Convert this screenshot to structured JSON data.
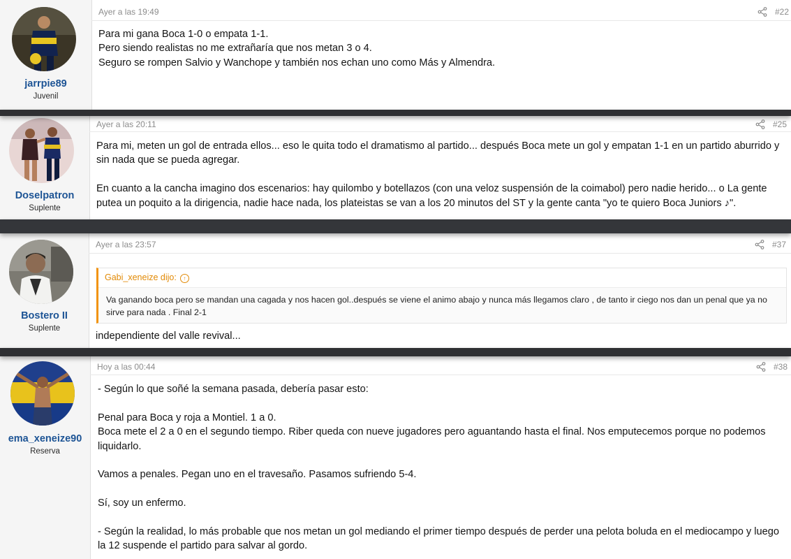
{
  "posts": [
    {
      "username": "jarrpie89",
      "user_title": "Juvenil",
      "timestamp": "Ayer a las 19:49",
      "post_number": "#22",
      "paragraphs": [
        "Para mi gana Boca 1-0 o empata 1-1.",
        "Pero siendo realistas no me extrañaría que nos metan 3 o 4.",
        "Seguro se rompen Salvio y Wanchope y también nos echan uno como Más y Almendra."
      ]
    },
    {
      "username": "Doselpatron",
      "user_title": "Suplente",
      "timestamp": "Ayer a las 20:11",
      "post_number": "#25",
      "paragraphs": [
        "Para mi, meten un gol de entrada ellos... eso le quita todo el dramatismo al partido... después Boca mete un gol y empatan 1-1 en un partido aburrido y sin nada que se pueda agregar.",
        "",
        "En cuanto a la cancha imagino dos escenarios: hay quilombo y botellazos (con una veloz suspensión de la coimabol) pero nadie herido... o La gente putea un poquito a la dirigencia, nadie hace nada, los plateistas se van a los 20 minutos del ST y la gente canta \"yo te quiero Boca Juniors ♪\"."
      ]
    },
    {
      "username": "Bostero II",
      "user_title": "Suplente",
      "timestamp": "Ayer a las 23:57",
      "post_number": "#37",
      "quote": {
        "author_line": "Gabi_xeneize dijo:",
        "arrow_icon": "↑",
        "text": "Va ganando boca pero se mandan una cagada y nos hacen gol..después se viene el animo abajo y nunca más llegamos claro , de tanto ir ciego nos dan un penal que ya no sirve para nada . Final 2-1"
      },
      "paragraphs": [
        "independiente del valle revival..."
      ]
    },
    {
      "username": "ema_xeneize90",
      "user_title": "Reserva",
      "timestamp": "Hoy a las 00:44",
      "post_number": "#38",
      "paragraphs": [
        "- Según lo que soñé la semana pasada, debería pasar esto:",
        "",
        "Penal para Boca y roja a Montiel. 1 a 0.",
        "Boca mete el 2 a 0 en el segundo tiempo. Riber queda con nueve jugadores pero aguantando hasta el final. Nos emputecemos porque no podemos liquidarlo.",
        "",
        "Vamos a penales. Pegan uno en el travesaño. Pasamos sufriendo 5-4.",
        "",
        "Sí, soy un enfermo.",
        "",
        "- Según la realidad, lo más probable que nos metan un gol mediando el primer tiempo después de perder una pelota boluda en el mediocampo y luego la 12 suspende el partido para salvar al gordo."
      ]
    }
  ],
  "icons": {
    "share": "share-icon",
    "quote_arrow": "arrow-up-circle-icon"
  },
  "colors": {
    "username": "#1d5495",
    "quote_accent": "#f2930d",
    "separator": "#2f3033",
    "meta_text": "#8c8c8c"
  }
}
